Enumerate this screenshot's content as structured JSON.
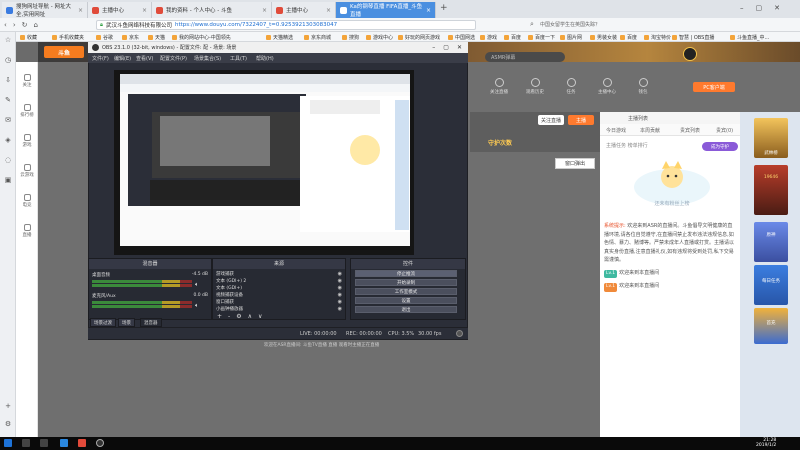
{
  "browser": {
    "tabs": [
      {
        "label": "搜狗网址导航 - 网址大全,实用网址",
        "active": false
      },
      {
        "label": "主播中心",
        "active": false
      },
      {
        "label": "我的资料 - 个人中心 - 斗鱼",
        "active": false
      },
      {
        "label": "主播中心",
        "active": false
      },
      {
        "label": "Ka的钢琴直播 FIFA直播_斗鱼直播",
        "active": true
      }
    ],
    "new_tab": "+",
    "url_site": "武汉斗鱼网络科技有限公司",
    "url": "https://www.douyu.com/7322407_t=0.9253921303083047",
    "search_hint": "中国女留学生在英国失踪？",
    "bookmarks": [
      "收藏",
      "手机收藏夹",
      "谷歌",
      "京东",
      "天猫",
      "我的网站中心-中国领先",
      "天猫精选",
      "京东商城",
      "搜狗",
      "游戏中心",
      "好玩的网页游戏",
      "中国网选",
      "游戏",
      "百度",
      "百度一下",
      "图片网",
      "男装女装",
      "百度",
      "淘宝特价",
      "网易考拉",
      "斗鱼",
      "阿里巴巴",
      "智慧 | OBS直播",
      "斗鱼直播_中..."
    ]
  },
  "rail2": [
    "关注",
    "排行榜",
    "游戏",
    "云游戏",
    "电竞",
    "直播"
  ],
  "douyu": {
    "logo": "斗鱼",
    "search_placeholder": "ASMR弹幕",
    "top_icons": [
      "关注直播",
      "观看历史",
      "任务",
      "主播中心",
      "钱包"
    ],
    "pc_client": "PC客户端",
    "login": "关注直播",
    "follow": "主播",
    "guard_label": "守护次数",
    "popout": "窗口弹出"
  },
  "chat": {
    "header": "主播列表",
    "tabs": [
      "今日游戏",
      "本周贡献",
      "贵宾列表",
      "贵宾(0)"
    ],
    "note": "主播任务 榜单排行",
    "guard_btn": "成为守护",
    "mascot_caption": "还未有粉丝上榜",
    "messages": [
      {
        "prefix": "系统提示:",
        "text": "欢迎来到ASR的直播间。斗鱼倡导文明健康的直播环境,请各位自觉遵守,在直播间禁止发布违法违规信息,如色情、暴力、赌博等。严禁未成年人直播或打赏。主播请以真实身份直播,注意直播礼仪,如有违规将受到处罚,私下交易需谨慎。"
      },
      {
        "prefix": "Lv.1",
        "text": "欢迎来到本直播间"
      },
      {
        "prefix": "Lv.1",
        "text": "欢迎来到本直播间"
      }
    ]
  },
  "ads": [
    "武林榜",
    "19646",
    "原神",
    "每日任务",
    "首充",
    "签到"
  ],
  "obs": {
    "title": "OBS 23.1.0 (32-bit, windows) - 配置文件: 配 - 场景: 场景",
    "menu": [
      "文件(F)",
      "编辑(E)",
      "查看(V)",
      "配置文件(P)",
      "场景集合(S)",
      "工具(T)",
      "帮助(H)"
    ],
    "docks": {
      "mixer": "混音器",
      "sources": "来源",
      "controls": "控件"
    },
    "mixer_rows": [
      {
        "name": "桌面音频",
        "db": "-4.5 dB"
      },
      {
        "name": "麦克风/Aux",
        "db": "0.0 dB"
      }
    ],
    "sources": [
      "游戏捕获",
      "文本 (GDI+) 2",
      "文本 (GDI+)",
      "视频捕获设备",
      "窗口捕获",
      "小画钟播放器",
      "显示器捕获"
    ],
    "source_tools": [
      "+",
      "-",
      "⚙",
      "∧",
      "∨"
    ],
    "controls": [
      "停止推流",
      "开始录制",
      "工作室模式",
      "设置",
      "退出"
    ],
    "bottom_tabs": [
      "场景过渡",
      "场景",
      "混音器"
    ],
    "status": {
      "live": "LIVE: 00:00:00",
      "rec": "REC: 00:00:00",
      "cpu": "CPU: 3.5%",
      "fps": "30.00 fps"
    },
    "below": "欢迎在ASR直播间: 斗鱼TV直播 直播 观看时主播正在直播"
  },
  "taskbar": {
    "time": "21:28",
    "date": "2019/1/2"
  },
  "colors": {
    "accent": "#ff7a2e",
    "obs_bg": "#2b2e38",
    "tab_active": "#4a8fe0"
  }
}
